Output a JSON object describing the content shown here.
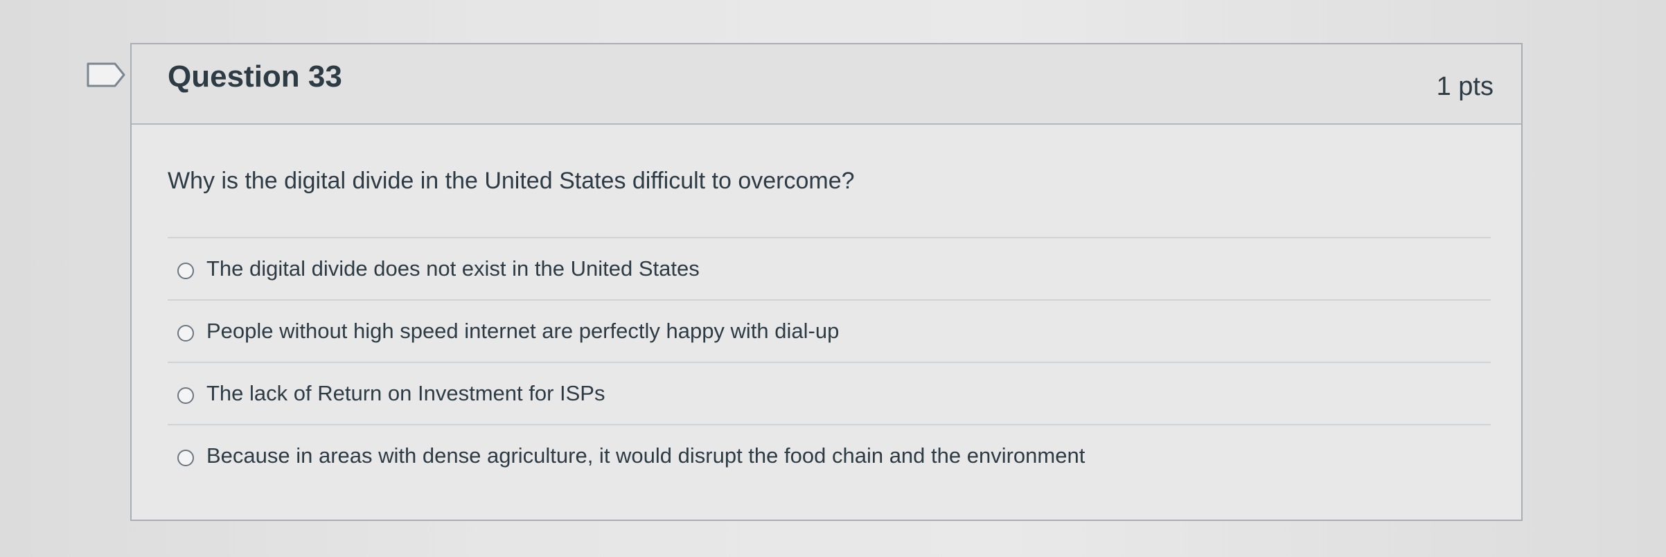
{
  "question": {
    "title": "Question 33",
    "points": "1 pts",
    "text": "Why is the digital divide in the United States difficult to overcome?",
    "answers": [
      {
        "label": "The digital divide does not exist in the United States"
      },
      {
        "label": "People without high speed internet are perfectly happy with dial-up"
      },
      {
        "label": "The lack of Return on Investment for ISPs"
      },
      {
        "label": "Because in areas with dense agriculture, it would disrupt the food chain and the environment"
      }
    ]
  },
  "icons": {
    "flag": "flag-question-icon",
    "radio": "radio-unselected-icon"
  },
  "colors": {
    "text": "#2d3b45",
    "header_bg": "#e1e1e1",
    "border": "#a9aeb3"
  }
}
